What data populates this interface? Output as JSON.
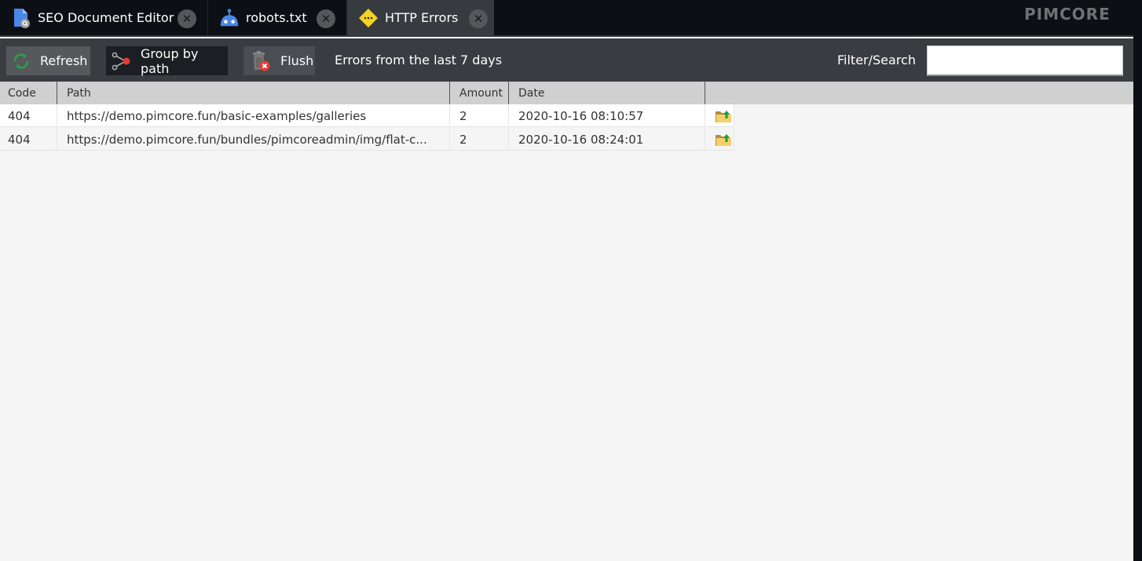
{
  "tabs": [
    {
      "label": "SEO Document Editor",
      "icon": "seo-document-icon",
      "active": false
    },
    {
      "label": "robots.txt",
      "icon": "robot-icon",
      "active": false
    },
    {
      "label": "HTTP Errors",
      "icon": "warning-diamond-icon",
      "active": true
    }
  ],
  "brand": "PIMCORE",
  "toolbar": {
    "refresh_label": "Refresh",
    "group_by_path_label": "Group by path",
    "flush_label": "Flush",
    "status_text": "Errors from the last 7 days",
    "filter_label": "Filter/Search",
    "filter_value": "",
    "filter_placeholder": ""
  },
  "grid": {
    "columns": [
      "Code",
      "Path",
      "Amount",
      "Date",
      ""
    ],
    "rows": [
      {
        "code": "404",
        "path": "https://demo.pimcore.fun/basic-examples/galleries",
        "amount": "2",
        "date": "2020-10-16 08:10:57",
        "action_icon": "open-folder-icon"
      },
      {
        "code": "404",
        "path": "https://demo.pimcore.fun/bundles/pimcoreadmin/img/flat-c...",
        "amount": "2",
        "date": "2020-10-16 08:24:01",
        "action_icon": "open-folder-icon"
      }
    ]
  },
  "colors": {
    "tabbar_bg": "#0c1014",
    "active_tab_bg": "#373b3f",
    "toolbar_bg": "#393c40",
    "header_bg": "#d0d0d0",
    "refresh_green": "#2e9e4a",
    "accent_red": "#e53935",
    "warning_yellow": "#f5d320"
  }
}
